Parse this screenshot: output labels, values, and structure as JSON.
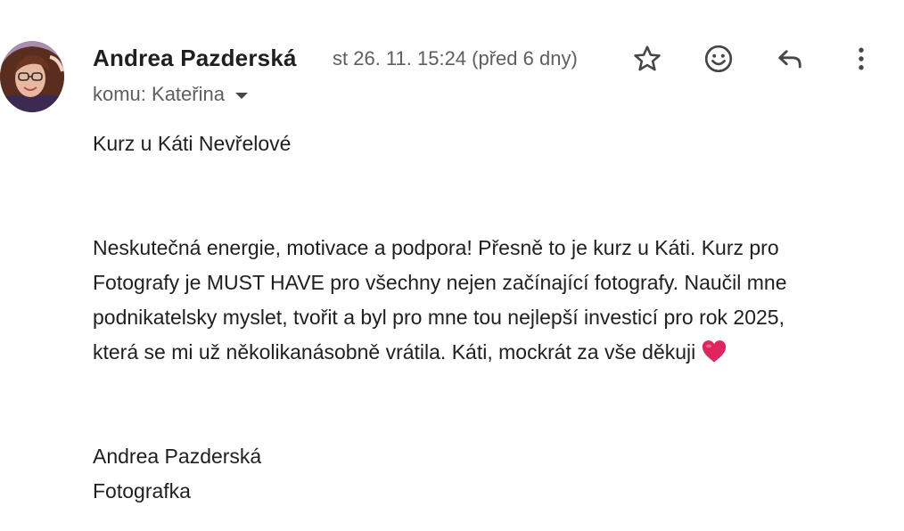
{
  "sender": {
    "name": "Andrea Pazderská",
    "timestamp": "st 26. 11. 15:24 (před 6 dny)"
  },
  "recipient": {
    "label": "komu: Kateřina"
  },
  "actions": {
    "star_icon": "star-icon",
    "emoji_icon": "emoji-reaction-icon",
    "reply_icon": "reply-icon",
    "more_icon": "more-vertical-icon"
  },
  "message": {
    "subject_line": "Kurz u Káti Nevřelové",
    "paragraph_lines": [
      "Neskutečná energie, motivace a podpora! Přesně to je kurz u Káti. Kurz pro",
      "Fotografy je MUST HAVE pro všechny nejen začínající fotografy. Naučil mne",
      "podnikatelsky myslet, tvořit a byl pro mne tou nejlepší investicí pro rok 2025,",
      "která se mi už několikanásobně vrátila. Káti, mockrát za vše děkuji"
    ],
    "heart_icon": "red-heart-emoji-icon",
    "signature_name": "Andrea Pazderská",
    "signature_title": "Fotografka"
  },
  "colors": {
    "text_primary": "#1f1f1f",
    "text_secondary": "#5e5e5e",
    "icon": "#444746",
    "heart": "#e0245e"
  }
}
